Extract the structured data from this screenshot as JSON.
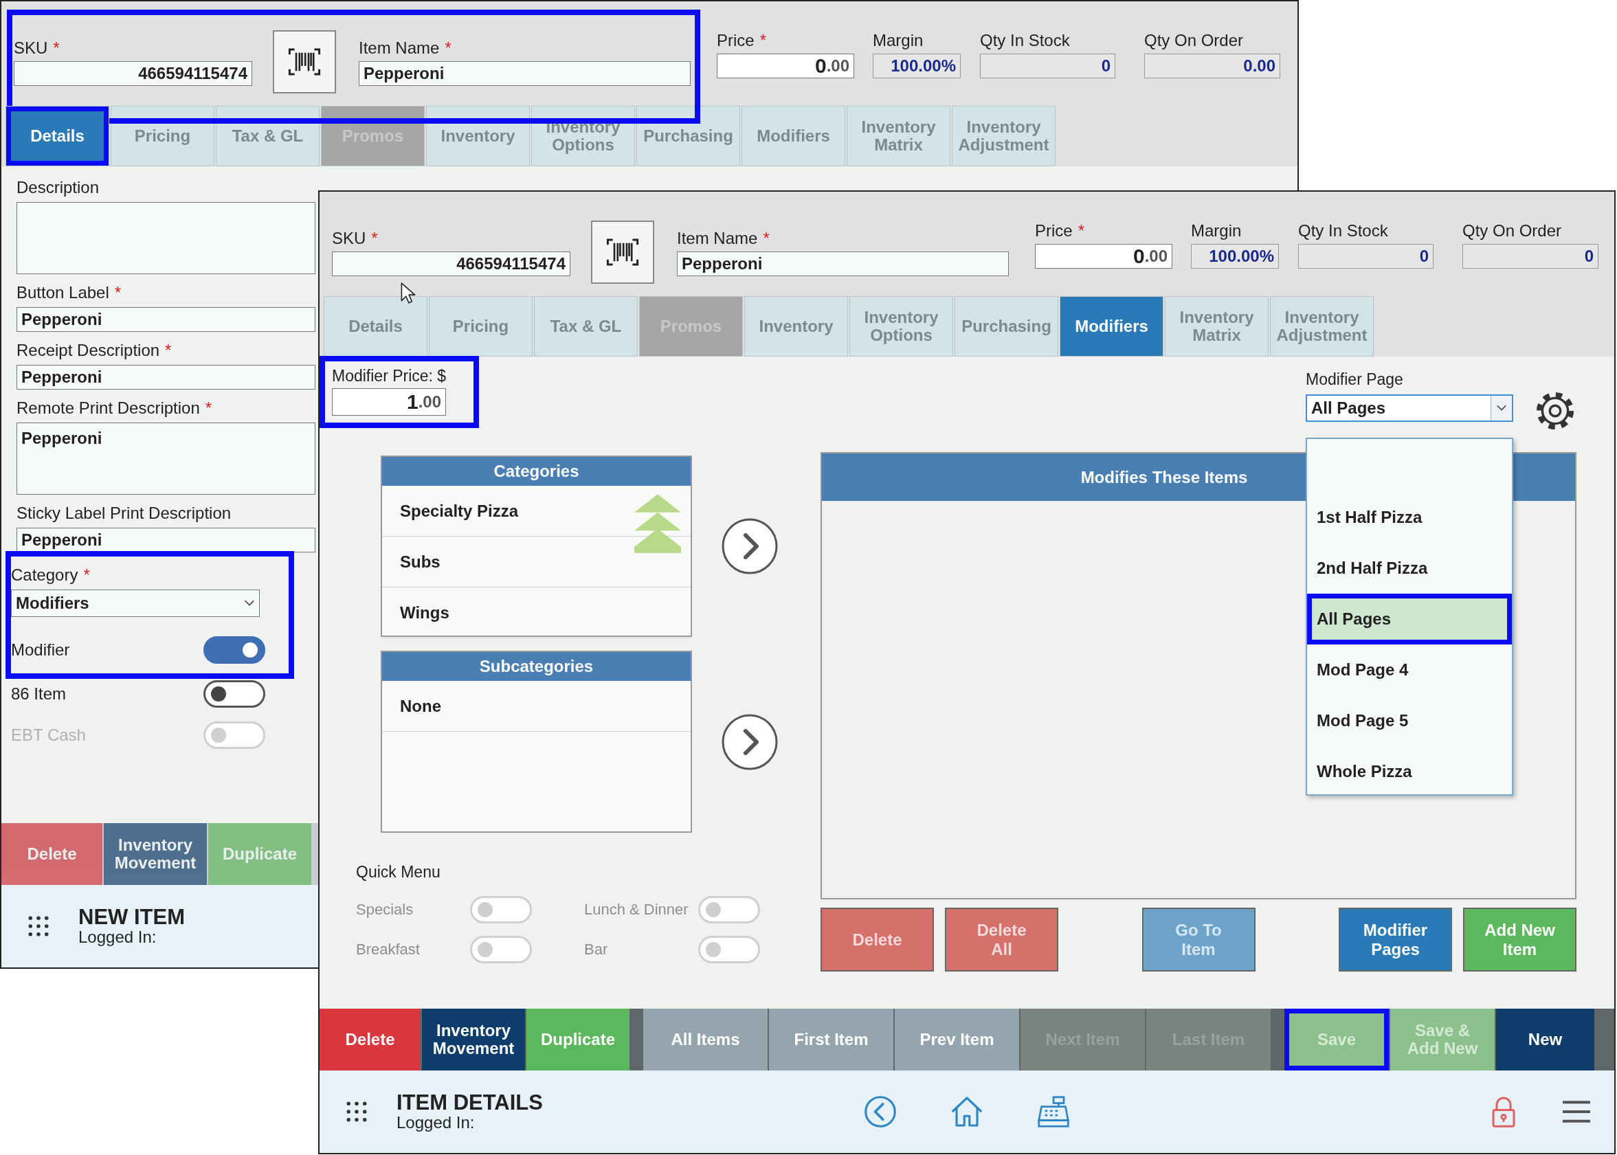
{
  "windows": [
    {
      "active": false,
      "identity": {
        "highlighted": true,
        "sku": {
          "label": "SKU",
          "mark": "*",
          "value": "466594115474"
        },
        "item_name": {
          "label": "Item Name",
          "mark": "*",
          "value": "Pepperoni"
        }
      },
      "figures": {
        "price": {
          "label": "Price",
          "mark": "*",
          "whole": "0",
          "fraction": ".00"
        },
        "margin": {
          "label": "Margin",
          "value": "100.00%"
        },
        "qty_in_stock": {
          "label": "Qty In Stock",
          "value": "0"
        },
        "qty_on_order": {
          "label": "Qty On Order",
          "value": "0.00"
        }
      },
      "tabs": [
        {
          "label": "Details",
          "selected": true,
          "disabled": false,
          "highlighted": true
        },
        {
          "label": "Pricing",
          "selected": false,
          "disabled": false,
          "highlighted": false
        },
        {
          "label": "Tax & GL",
          "selected": false,
          "disabled": false,
          "highlighted": false
        },
        {
          "label": "Promos",
          "selected": false,
          "disabled": true,
          "highlighted": false
        },
        {
          "label": "Inventory",
          "selected": false,
          "disabled": false,
          "highlighted": false
        },
        {
          "label": "Inventory\nOptions",
          "selected": false,
          "disabled": false,
          "highlighted": false
        },
        {
          "label": "Purchasing",
          "selected": false,
          "disabled": false,
          "highlighted": false
        },
        {
          "label": "Modifiers",
          "selected": false,
          "disabled": false,
          "highlighted": false
        },
        {
          "label": "Inventory\nMatrix",
          "selected": false,
          "disabled": false,
          "highlighted": false
        },
        {
          "label": "Inventory\nAdjustment",
          "selected": false,
          "disabled": false,
          "highlighted": false
        }
      ],
      "body": {
        "kind": "details",
        "fields": [
          {
            "kind": "textarea",
            "label": "Description"
          },
          {
            "kind": "text",
            "label": "Button Label",
            "mark": "*",
            "value": "Pepperoni"
          },
          {
            "kind": "text",
            "label": "Receipt Description",
            "mark": "*",
            "value": "Pepperoni"
          },
          {
            "kind": "textarea",
            "label": "Remote Print Description",
            "mark": "*",
            "value": "Pepperoni"
          },
          {
            "kind": "text",
            "label": "Sticky Label Print Description",
            "value": "Pepperoni"
          }
        ],
        "category_group": {
          "highlighted": true,
          "category": {
            "label": "Category",
            "mark": "*",
            "value": "Modifiers"
          },
          "toggle": {
            "label": "Modifier",
            "on": true,
            "disabled": false
          }
        },
        "toggles": [
          {
            "label": "86 Item",
            "on": false,
            "disabled": false
          },
          {
            "label": "EBT Cash",
            "on": false,
            "disabled": true
          }
        ]
      },
      "bottom_bar": {
        "groups": [
          {
            "buttons": [
              {
                "label": "Delete",
                "kind": "delete",
                "disabled": false,
                "highlighted": false
              },
              {
                "label": "Inventory\nMovement",
                "kind": "movement",
                "disabled": false,
                "highlighted": false
              },
              {
                "label": "Duplicate",
                "kind": "duplicate",
                "disabled": false,
                "highlighted": false
              }
            ]
          }
        ]
      },
      "footer": {
        "title": "NEW ITEM",
        "subtitle": "Logged In:"
      }
    },
    {
      "active": true,
      "identity": {
        "sku": {
          "label": "SKU",
          "mark": "*",
          "value": "466594115474"
        },
        "item_name": {
          "label": "Item Name",
          "mark": "*",
          "value": "Pepperoni"
        }
      },
      "figures": {
        "price": {
          "label": "Price",
          "mark": "*",
          "whole": "0",
          "fraction": ".00"
        },
        "margin": {
          "label": "Margin",
          "value": "100.00%"
        },
        "qty_in_stock": {
          "label": "Qty In Stock",
          "value": "0"
        },
        "qty_on_order": {
          "label": "Qty On Order",
          "value": "0"
        }
      },
      "tabs": [
        {
          "label": "Details",
          "selected": false,
          "disabled": false,
          "highlighted": false
        },
        {
          "label": "Pricing",
          "selected": false,
          "disabled": false,
          "highlighted": false
        },
        {
          "label": "Tax & GL",
          "selected": false,
          "disabled": false,
          "highlighted": false
        },
        {
          "label": "Promos",
          "selected": false,
          "disabled": true,
          "highlighted": false
        },
        {
          "label": "Inventory",
          "selected": false,
          "disabled": false,
          "highlighted": false
        },
        {
          "label": "Inventory\nOptions",
          "selected": false,
          "disabled": false,
          "highlighted": false
        },
        {
          "label": "Purchasing",
          "selected": false,
          "disabled": false,
          "highlighted": false
        },
        {
          "label": "Modifiers",
          "selected": true,
          "disabled": false,
          "highlighted": false
        },
        {
          "label": "Inventory\nMatrix",
          "selected": false,
          "disabled": false,
          "highlighted": false
        },
        {
          "label": "Inventory\nAdjustment",
          "selected": false,
          "disabled": false,
          "highlighted": false
        }
      ],
      "body": {
        "kind": "modifiers",
        "modifier_price": {
          "label": "Modifier Price: $",
          "whole": "1",
          "fraction": ".00",
          "highlighted": true
        },
        "modifier_page": {
          "label": "Modifier Page",
          "value": "All Pages",
          "expanded": true,
          "options": [
            {
              "label": "1st Half Pizza",
              "selected": false,
              "highlighted": false
            },
            {
              "label": "2nd Half Pizza",
              "selected": false,
              "highlighted": false
            },
            {
              "label": "All Pages",
              "selected": true,
              "highlighted": true
            },
            {
              "label": "Mod Page 4",
              "selected": false,
              "highlighted": false
            },
            {
              "label": "Mod Page 5",
              "selected": false,
              "highlighted": false
            },
            {
              "label": "Whole Pizza",
              "selected": false,
              "highlighted": false
            }
          ]
        },
        "lists": [
          {
            "title": "Categories",
            "items": [
              "Specialty Pizza",
              "Subs",
              "Wings"
            ],
            "scroll_up": true
          },
          {
            "title": "Subcategories",
            "items": [
              "None"
            ],
            "scroll_up": false
          }
        ],
        "panel": {
          "title": "Modifies These Items"
        },
        "panel_buttons": {
          "groups": [
            {
              "buttons": [
                {
                  "label": "Delete",
                  "kind": "delete"
                },
                {
                  "label": "Delete\nAll",
                  "kind": "delete"
                }
              ]
            },
            {
              "buttons": [
                {
                  "label": "Go To\nItem",
                  "kind": "goto"
                }
              ]
            },
            {
              "buttons": [
                {
                  "label": "Modifier\nPages",
                  "kind": "pages"
                },
                {
                  "label": "Add New\nItem",
                  "kind": "add"
                }
              ]
            }
          ]
        },
        "quick_menu": {
          "title": "Quick Menu",
          "toggles": [
            {
              "label": "Specials",
              "on": false,
              "disabled": true
            },
            {
              "label": "Lunch & Dinner",
              "on": false,
              "disabled": true
            },
            {
              "label": "Breakfast",
              "on": false,
              "disabled": true
            },
            {
              "label": "Bar",
              "on": false,
              "disabled": true
            }
          ]
        }
      },
      "bottom_bar": {
        "groups": [
          {
            "buttons": [
              {
                "label": "Delete",
                "kind": "delete",
                "disabled": false,
                "highlighted": false
              },
              {
                "label": "Inventory\nMovement",
                "kind": "movement",
                "disabled": false,
                "highlighted": false
              },
              {
                "label": "Duplicate",
                "kind": "duplicate",
                "disabled": false,
                "highlighted": false
              }
            ]
          },
          {
            "buttons": [
              {
                "label": "All Items",
                "kind": "nav",
                "disabled": false,
                "highlighted": false
              },
              {
                "label": "First Item",
                "kind": "nav",
                "disabled": false,
                "highlighted": false
              },
              {
                "label": "Prev Item",
                "kind": "nav",
                "disabled": false,
                "highlighted": false
              },
              {
                "label": "Next Item",
                "kind": "nav",
                "disabled": true,
                "highlighted": false
              },
              {
                "label": "Last Item",
                "kind": "nav",
                "disabled": true,
                "highlighted": false
              }
            ]
          },
          {
            "buttons": [
              {
                "label": "Save",
                "kind": "save",
                "disabled": true,
                "highlighted": true
              },
              {
                "label": "Save &\nAdd New",
                "kind": "save",
                "disabled": true,
                "highlighted": false
              },
              {
                "label": "New",
                "kind": "new",
                "disabled": false,
                "highlighted": false
              }
            ]
          }
        ]
      },
      "footer": {
        "title": "ITEM DETAILS",
        "subtitle": "Logged In:",
        "nav": true
      }
    }
  ]
}
